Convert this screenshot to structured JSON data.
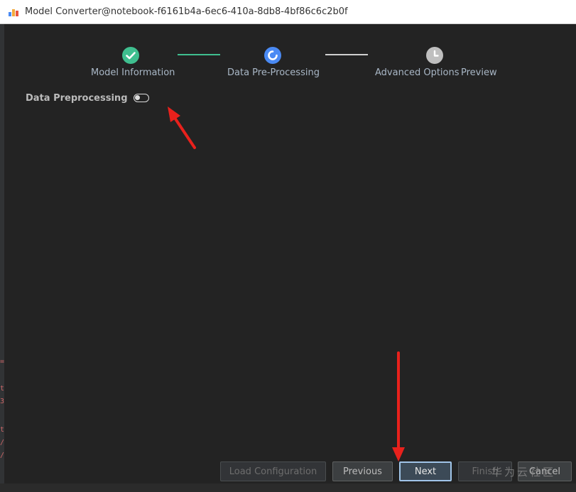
{
  "window": {
    "title": "Model Converter@notebook-f6161b4a-6ec6-410a-8db8-4bf86c6c2b0f"
  },
  "stepper": {
    "steps": [
      {
        "label": "Model Information",
        "state": "completed"
      },
      {
        "label": "Data Pre-Processing",
        "state": "in-progress"
      },
      {
        "label": "Advanced Options",
        "state": "pending"
      },
      {
        "label": "Preview",
        "state": "pending"
      }
    ]
  },
  "form": {
    "data_preprocessing_label": "Data Preprocessing",
    "data_preprocessing_enabled": false
  },
  "footer": {
    "load_configuration_label": "Load Configuration",
    "previous_label": "Previous",
    "next_label": "Next",
    "finish_label": "Finish",
    "cancel_label": "Cancel"
  },
  "watermark": "华为云社区",
  "colors": {
    "completed": "#3fbf8f",
    "in_progress": "#4a8af4",
    "pending": "#bfbfbf",
    "annotation_arrow": "#e8211c",
    "primary_button_border": "#a0c4e8"
  },
  "icons": {
    "completed": "check-circle-icon",
    "in_progress": "progress-circle-icon",
    "pending": "clock-icon",
    "app": "app-logo-icon"
  }
}
